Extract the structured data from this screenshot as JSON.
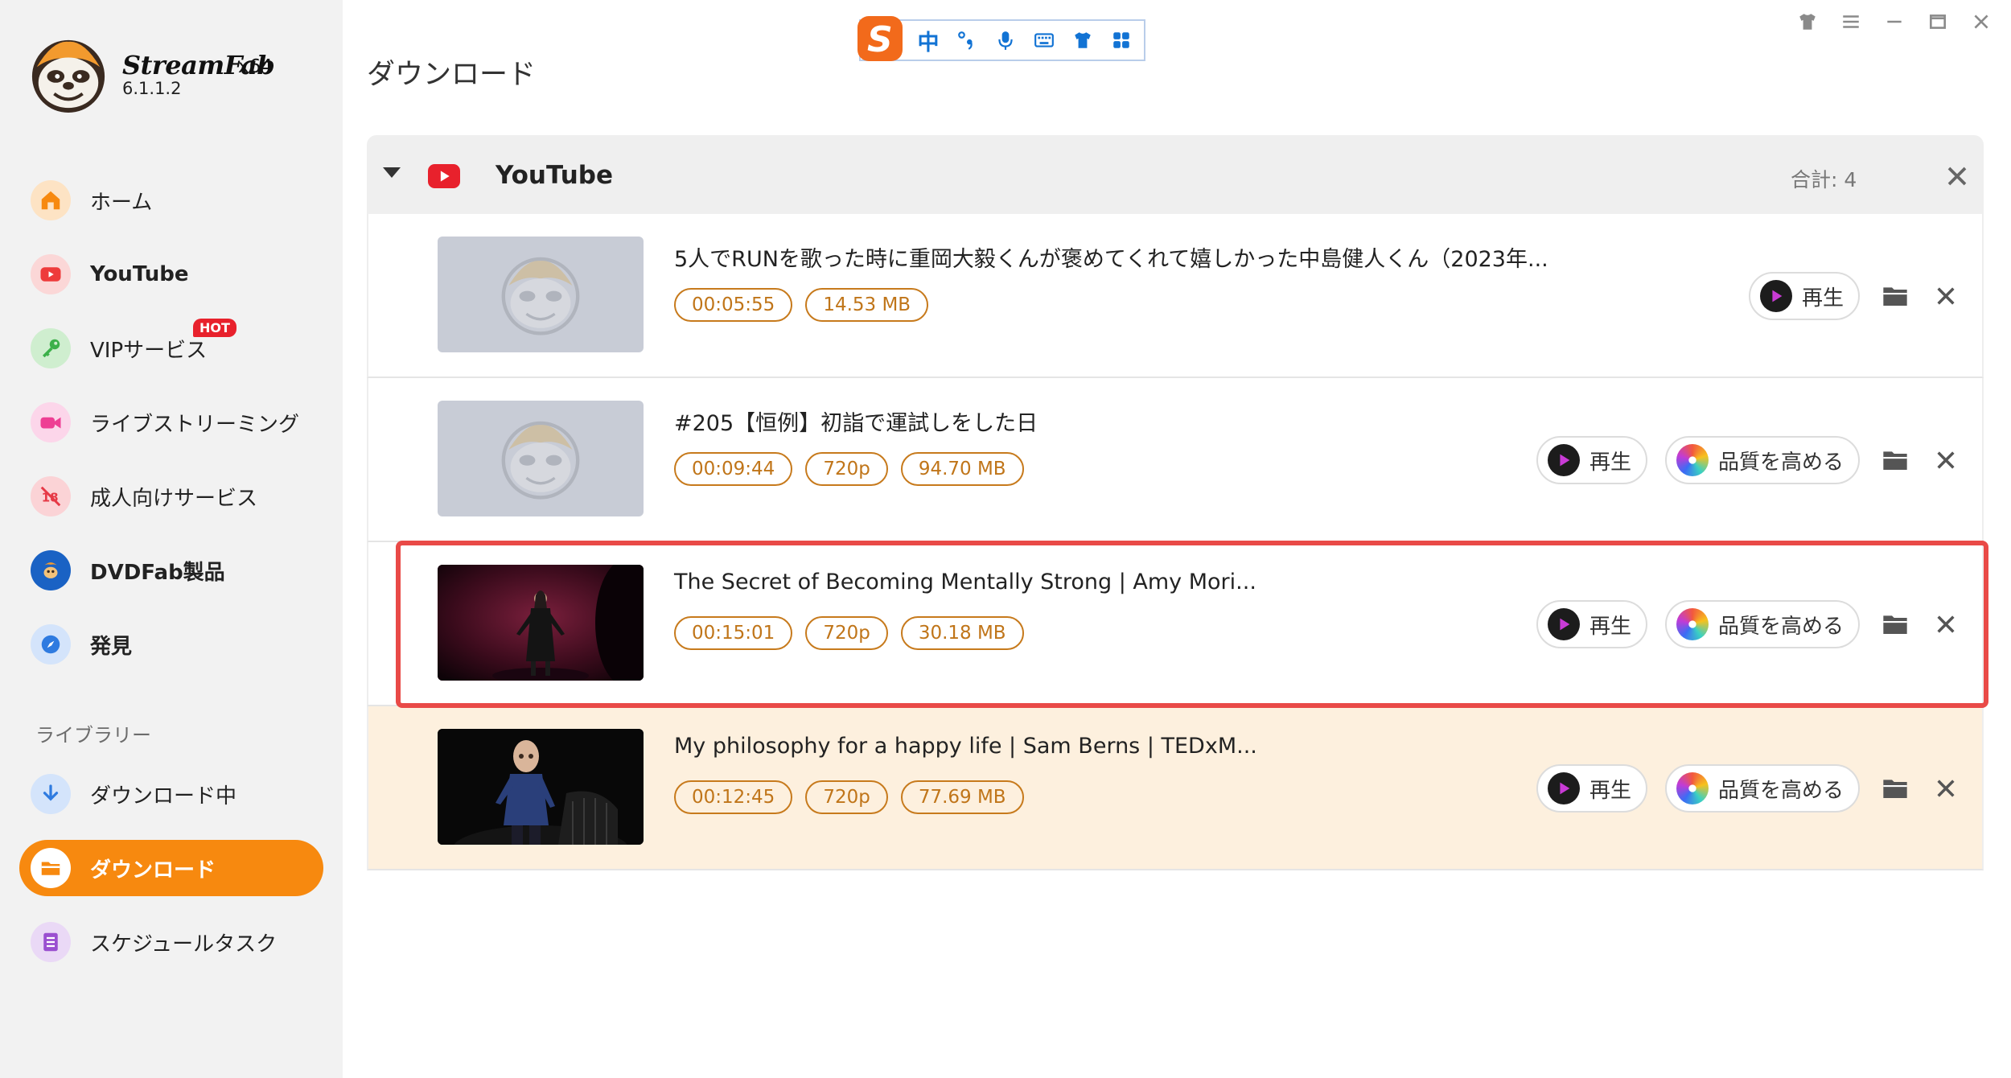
{
  "app": {
    "name": "StreamFab",
    "arch": "x64",
    "version": "6.1.1.2"
  },
  "sidebar": {
    "items": [
      {
        "label": "ホーム",
        "icon": "home-icon"
      },
      {
        "label": "YouTube",
        "icon": "youtube-icon"
      },
      {
        "label": "VIPサービス",
        "icon": "key-icon",
        "badge": "HOT"
      },
      {
        "label": "ライブストリーミング",
        "icon": "camera-icon"
      },
      {
        "label": "成人向けサービス",
        "icon": "adult-icon"
      },
      {
        "label": "DVDFab製品",
        "icon": "dvdfab-icon"
      },
      {
        "label": "発見",
        "icon": "compass-icon"
      }
    ],
    "library_label": "ライブラリー",
    "library_items": [
      {
        "label": "ダウンロード中",
        "icon": "download-icon"
      },
      {
        "label": "ダウンロード",
        "icon": "folder-icon",
        "active": true
      },
      {
        "label": "スケジュールタスク",
        "icon": "schedule-icon"
      }
    ]
  },
  "main": {
    "title": "ダウンロード",
    "group": {
      "name": "YouTube",
      "total": "合計: 4"
    },
    "play_label": "再生",
    "enhance_label": "品質を高める",
    "items": [
      {
        "title": "5人でRUNを歌った時に重岡大毅くんが褒めてくれて嬉しかった中島健人くん（2023年...",
        "tags": [
          "00:05:55",
          "14.53 MB"
        ],
        "thumbnail": "placeholder"
      },
      {
        "title": "#205【恒例】初詣で運試しをした日",
        "tags": [
          "00:09:44",
          "720p",
          "94.70 MB"
        ],
        "thumbnail": "placeholder"
      },
      {
        "title": "The Secret of Becoming Mentally Strong | Amy Mori...",
        "tags": [
          "00:15:01",
          "720p",
          "30.18 MB"
        ],
        "thumbnail": "stage-red"
      },
      {
        "title": "My philosophy for a happy life | Sam Berns | TEDxM...",
        "tags": [
          "00:12:45",
          "720p",
          "77.69 MB"
        ],
        "thumbnail": "stage-dark"
      }
    ]
  },
  "ime": {
    "mode": "中"
  },
  "colors": {
    "accent": "#f7890f",
    "tag": "#c07519",
    "highlight": "#e94a47",
    "hover_row": "#fdf0de"
  }
}
